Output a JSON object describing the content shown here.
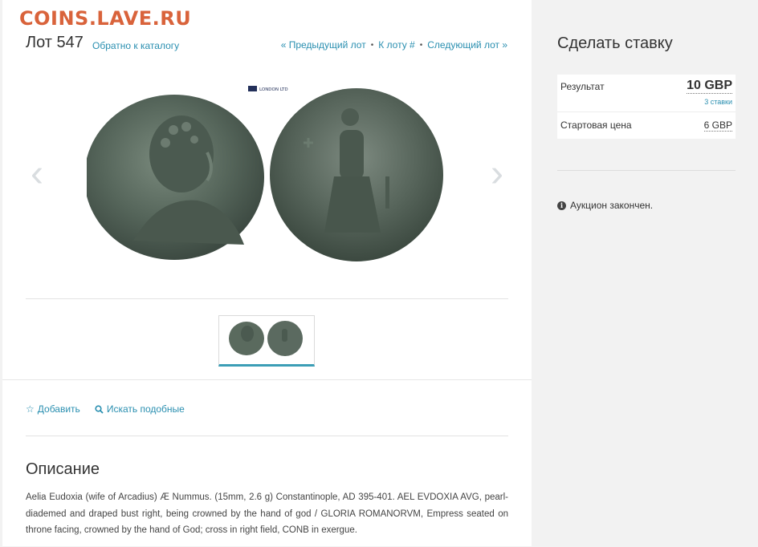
{
  "watermark": "COINS.LAVE.RU",
  "lot": {
    "title": "Лот 547",
    "back_link": "Обратно к каталогу",
    "prev_link": "« Предыдущий лот",
    "goto_link": "К лоту #",
    "next_link": "Следующий лот »"
  },
  "image": {
    "logo_text": "LONDON LTD"
  },
  "actions": {
    "add": "Добавить",
    "search_similar": "Искать подобные"
  },
  "description": {
    "heading": "Описание",
    "text": "Aelia Eudoxia (wife of Arcadius) Æ Nummus. (15mm, 2.6 g) Constantinople, AD 395-401. AEL EVDOXIA AVG, pearl-diademed and draped bust right, being crowned by the hand of god / GLORIA ROMANORVM, Empress seated on throne facing, crowned by the hand of God; cross in right field, CONB in exergue."
  },
  "bid": {
    "heading": "Сделать ставку",
    "result_label": "Результат",
    "result_value": "10 GBP",
    "bids_count": "3 ставки",
    "start_label": "Стартовая цена",
    "start_value": "6 GBP",
    "status": "Аукцион закончен."
  },
  "colors": {
    "link": "#2a8fb0",
    "watermark": "#d9633b",
    "thumb_active": "#3b9eb6"
  }
}
